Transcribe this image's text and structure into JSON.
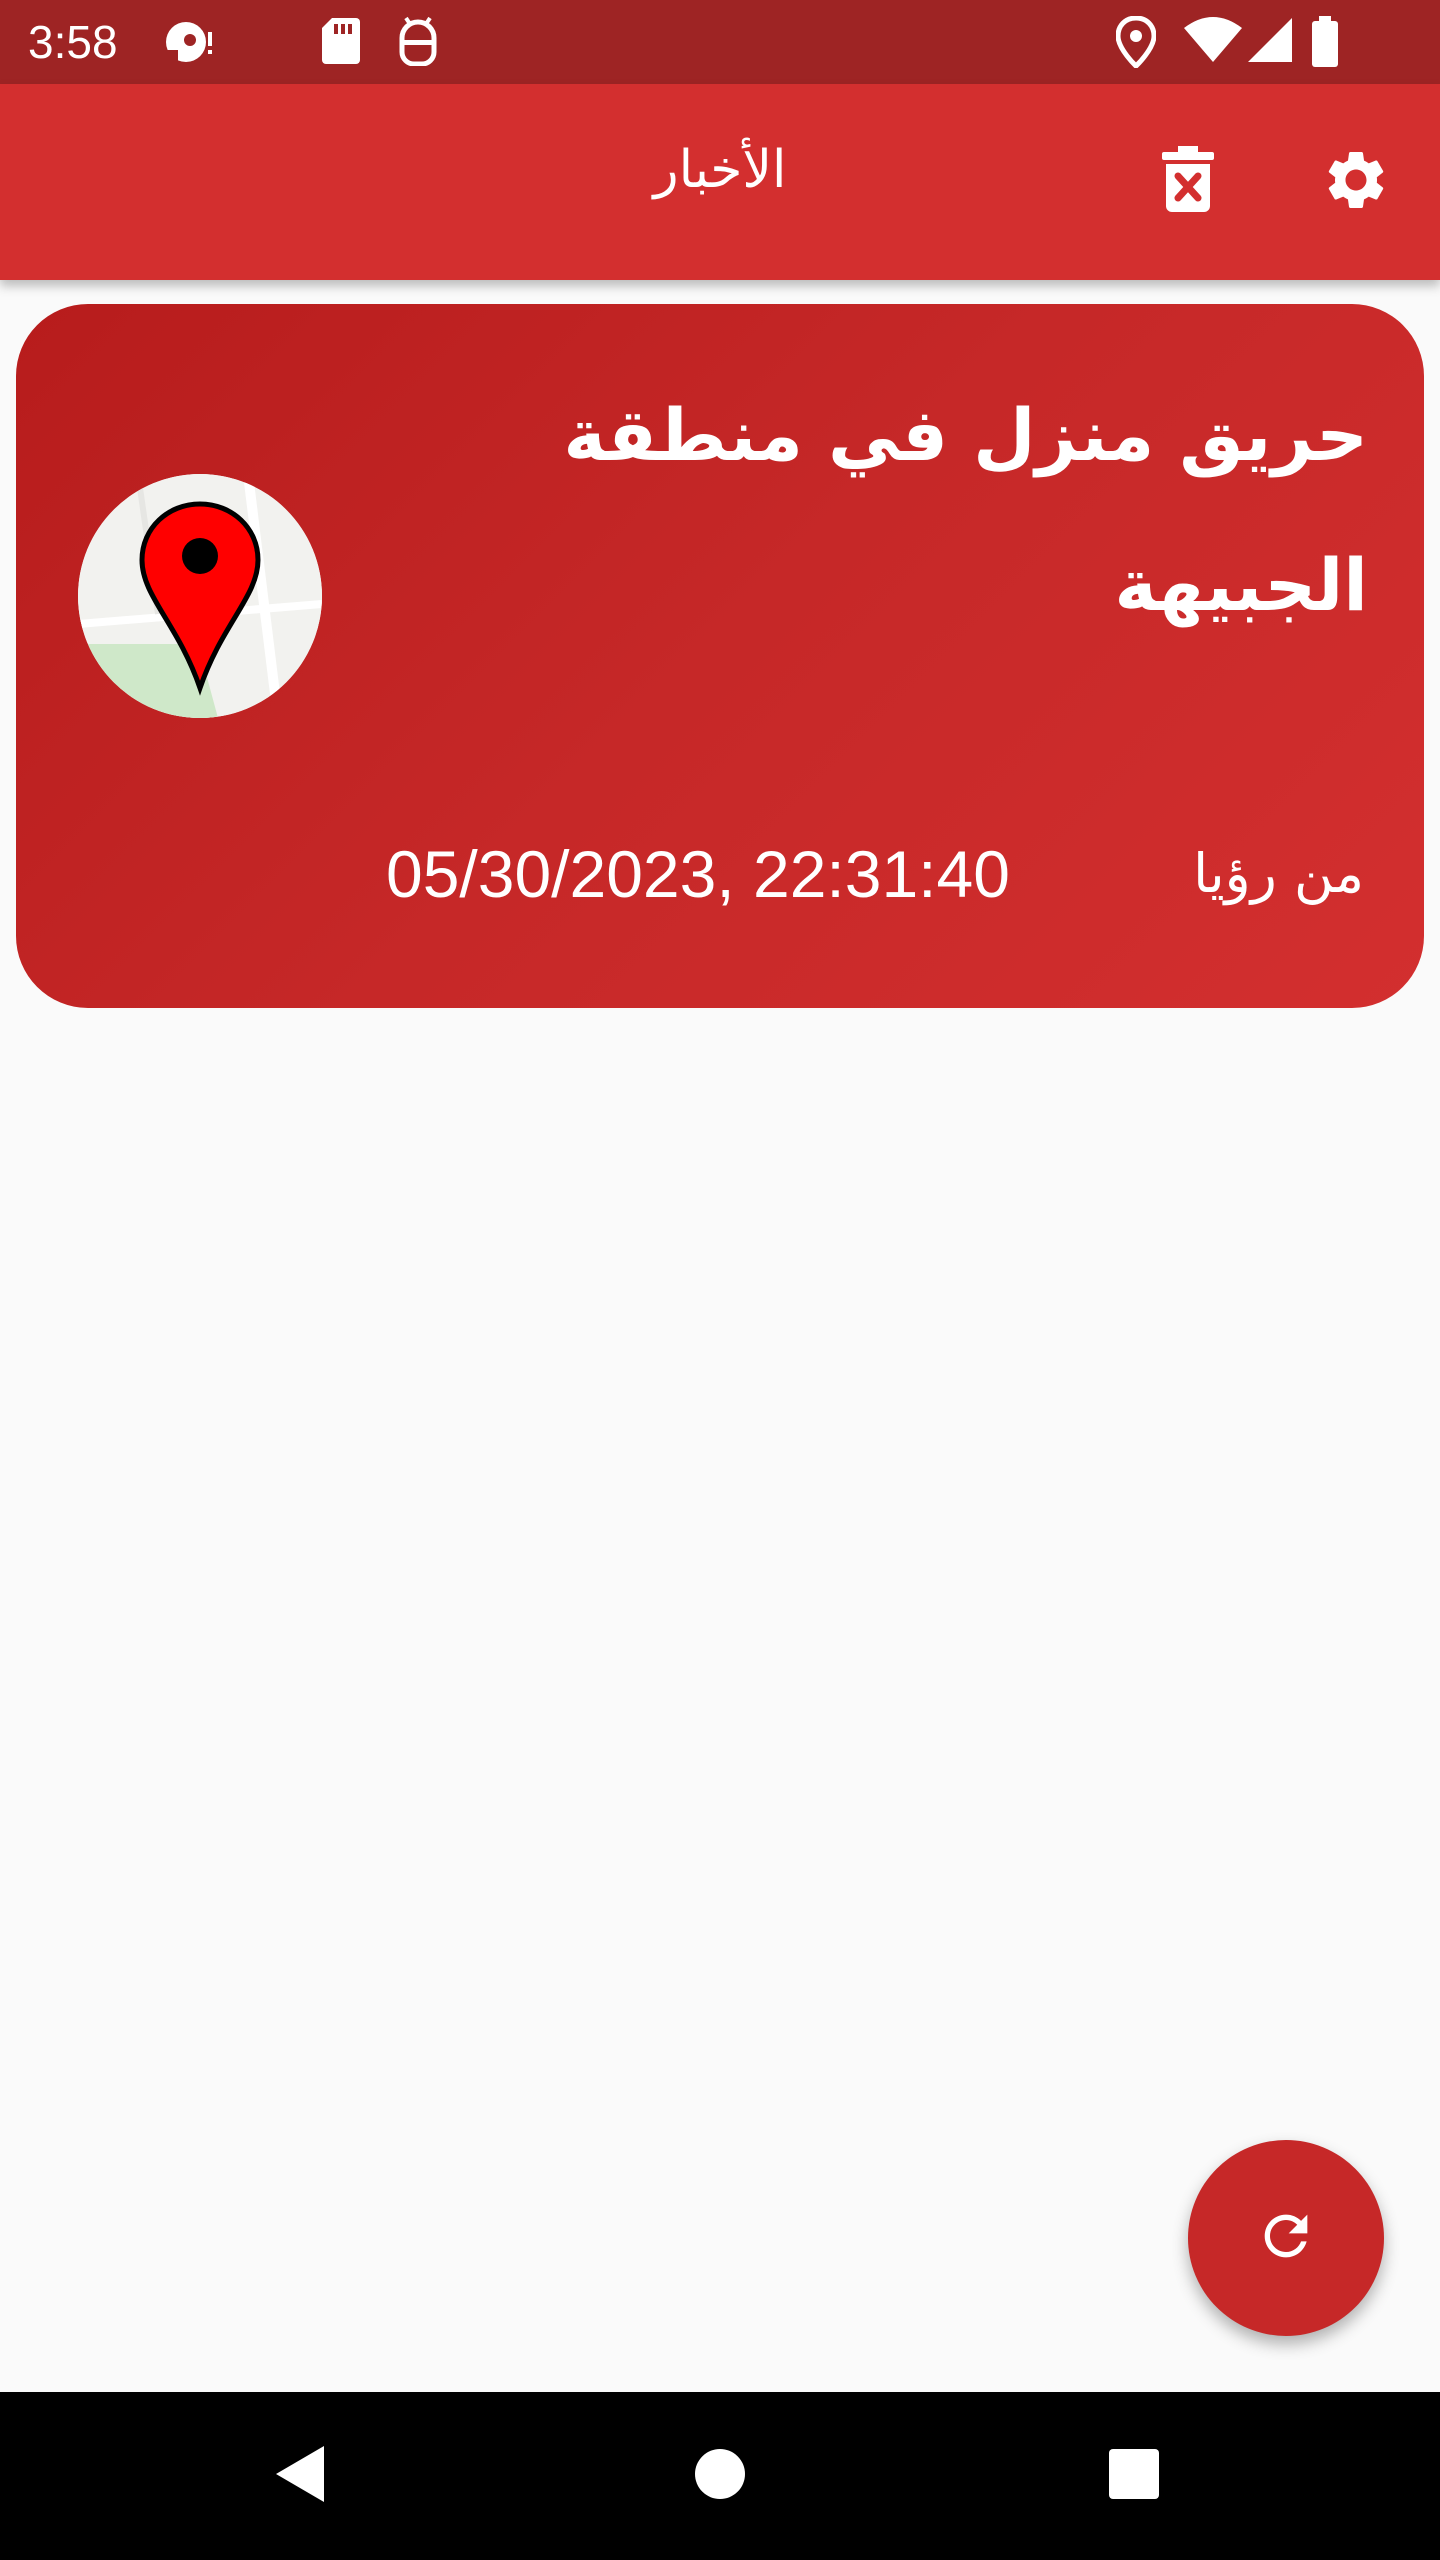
{
  "status_bar": {
    "time": "3:58",
    "icons": [
      "notification-icon",
      "sd-card-icon",
      "android-debug-icon",
      "location-icon",
      "wifi-icon",
      "signal-icon",
      "battery-icon"
    ]
  },
  "app_bar": {
    "title": "الأخبار",
    "actions": [
      "delete-all-icon",
      "settings-icon"
    ],
    "color": "#d32f2f"
  },
  "news": {
    "items": [
      {
        "title": "حريق منزل في منطقة الجبيهة",
        "source": "من رؤيا",
        "datetime": "05/30/2023, 22:31:40",
        "thumbnail_icon": "map-pin-icon"
      }
    ]
  },
  "fab": {
    "icon": "refresh-icon",
    "color": "#c62828"
  },
  "nav_bar": {
    "icons": [
      "back-icon",
      "home-icon",
      "recents-icon"
    ]
  }
}
